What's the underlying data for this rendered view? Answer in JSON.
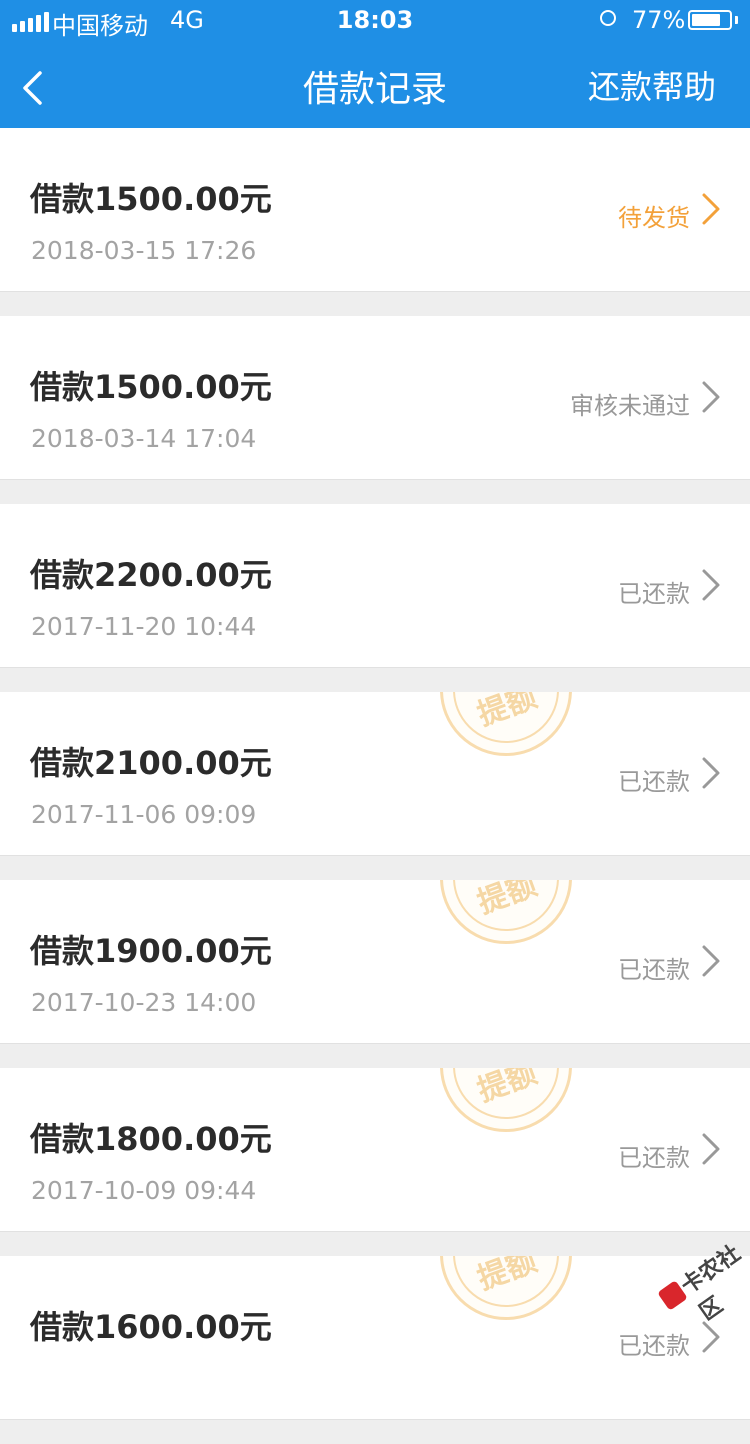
{
  "status_bar": {
    "carrier": "中国移动",
    "network": "4G",
    "time": "18:03",
    "battery_pct": "77%",
    "battery_level": 0.77
  },
  "nav": {
    "back_icon": "chevron-left-icon",
    "title": "借款记录",
    "help_label": "还款帮助"
  },
  "records": [
    {
      "amount": "借款1500.00元",
      "date": "2018-03-15 17:26",
      "status": "待发货",
      "status_color": "#f3a13a",
      "stamped": false
    },
    {
      "amount": "借款1500.00元",
      "date": "2018-03-14 17:04",
      "status": "审核未通过",
      "status_color": "#999999",
      "stamped": false
    },
    {
      "amount": "借款2200.00元",
      "date": "2017-11-20 10:44",
      "status": "已还款",
      "status_color": "#999999",
      "stamped": false
    },
    {
      "amount": "借款2100.00元",
      "date": "2017-11-06 09:09",
      "status": "已还款",
      "status_color": "#999999",
      "stamped": true
    },
    {
      "amount": "借款1900.00元",
      "date": "2017-10-23 14:00",
      "status": "已还款",
      "status_color": "#999999",
      "stamped": true
    },
    {
      "amount": "借款1800.00元",
      "date": "2017-10-09 09:44",
      "status": "已还款",
      "status_color": "#999999",
      "stamped": true
    },
    {
      "amount": "借款1600.00元",
      "date": "",
      "status": "已还款",
      "status_color": "#999999",
      "stamped": true
    }
  ],
  "stamp_text": "提额",
  "watermark_text": "卡农社区",
  "colors": {
    "header_bg": "#1f8fe5",
    "pending": "#f3a13a",
    "stamp": "#f8dcae"
  }
}
